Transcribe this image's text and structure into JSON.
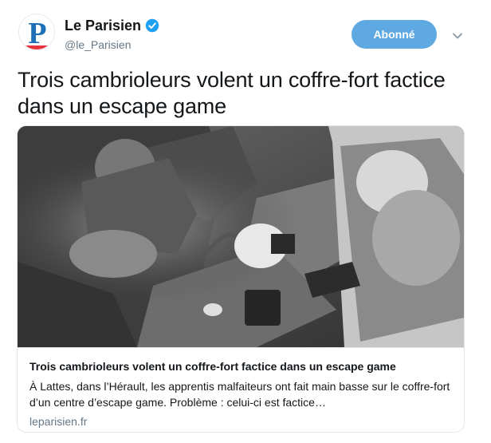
{
  "account": {
    "display_name": "Le Parisien",
    "handle": "@le_Parisien",
    "verified": true,
    "avatar_letter": "P"
  },
  "follow_button": {
    "label": "Abonné"
  },
  "more_menu": {
    "icon": "chevron-down-icon"
  },
  "tweet": {
    "text": "Trois cambrioleurs volent un coffre-fort factice dans un escape game"
  },
  "card": {
    "title": "Trois cambrioleurs volent un coffre-fort factice dans un escape game",
    "description": "À Lattes, dans l’Hérault, les apprentis malfaiteurs ont fait main basse sur le coffre-fort d’un centre d’escape game. Problème : celui-ci est factice…",
    "domain": "leparisien.fr"
  },
  "colors": {
    "follow_button": "#5fa9e2",
    "verified_badge": "#1da1f2",
    "secondary_text": "#657786",
    "card_border": "#e1e8ed"
  }
}
